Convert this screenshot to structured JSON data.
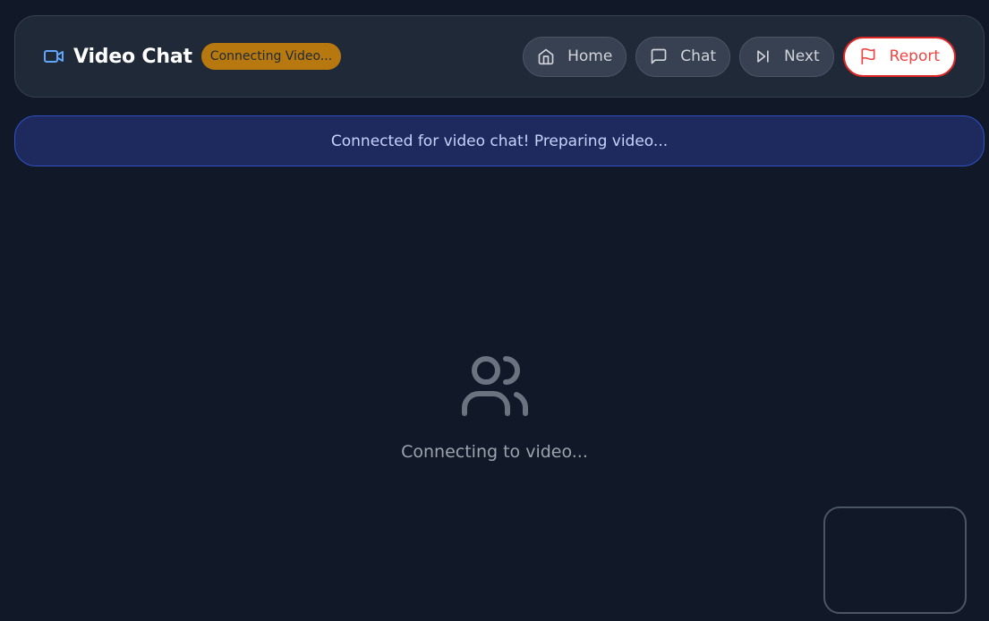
{
  "header": {
    "title": "Video Chat",
    "status_badge": "Connecting Video...",
    "brand_icon": "video-camera-icon",
    "nav": {
      "home": {
        "label": "Home",
        "icon": "home-icon"
      },
      "chat": {
        "label": "Chat",
        "icon": "message-square-icon"
      },
      "next": {
        "label": "Next",
        "icon": "skip-forward-icon"
      },
      "report": {
        "label": "Report",
        "icon": "flag-icon"
      }
    }
  },
  "notice": {
    "text": "Connected for video chat! Preparing video..."
  },
  "main": {
    "placeholder_icon": "users-icon",
    "status_text": "Connecting to video..."
  },
  "colors": {
    "background": "#111827",
    "panel": "#1f2937",
    "accent_blue": "#60a5fa",
    "badge": "#b7790f",
    "report_red": "#ef4444"
  }
}
